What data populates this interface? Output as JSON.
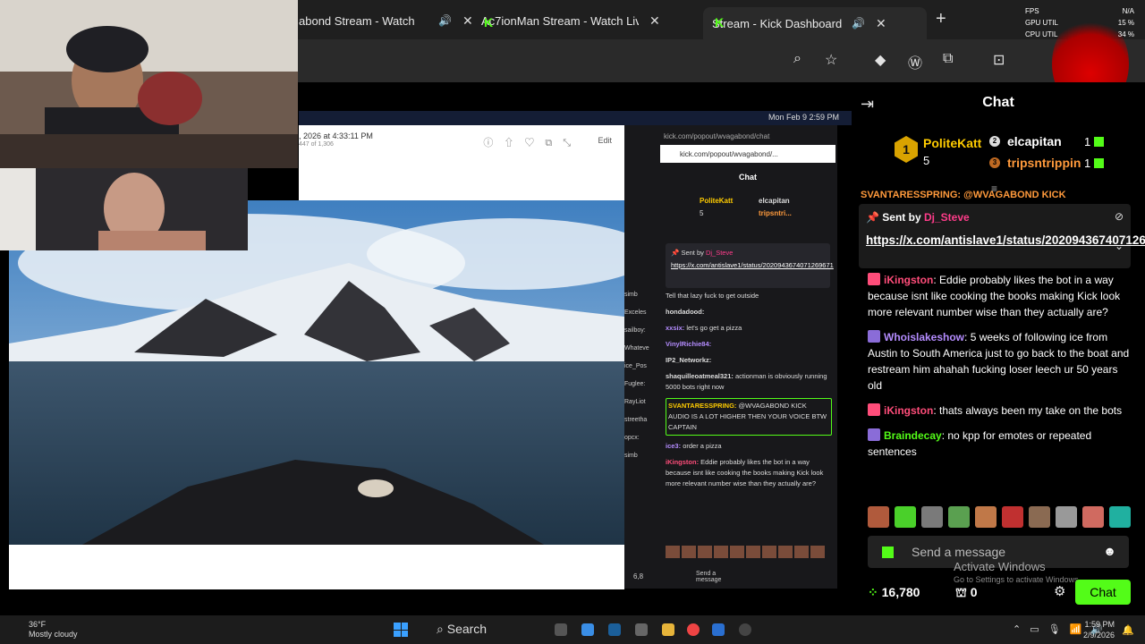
{
  "browser": {
    "tabs": [
      {
        "title": "abond Stream - Watch",
        "active": false
      },
      {
        "title": "Ac7ionMan Stream - Watch Liv",
        "active": false
      },
      {
        "title": "Stream - Kick Dashboard",
        "active": true
      }
    ],
    "new_tab_label": "+"
  },
  "overlay": {
    "fps_label": "FPS",
    "fps_value": "N/A",
    "gpu_label": "GPU UTIL",
    "gpu_value": "15 %",
    "cpu_label": "CPU UTIL",
    "cpu_value": "34 %"
  },
  "stream": {
    "mac_time": "Mon Feb 9  2:59 PM",
    "photo_date": ", 2026 at 4:33:11 PM",
    "photo_sub": "447 of 1,306",
    "photo_edit": "Edit",
    "inner": {
      "url1": "kick.com/popout/wvagabond/chat",
      "url2": "kick.com/popout/wvagabond/...",
      "chat_title": "Chat",
      "lead1": "PoliteKatt",
      "lead1_count": "5",
      "lead2": "elcapitan",
      "lead2_count": "1",
      "lead3": "tripsntri...",
      "lead3_count": "1",
      "pinned_by": "Sent by",
      "pinned_user": "Dj_Steve",
      "pinned_link": "https://x.com/antislave1/status/2020943674071269671",
      "side_labels": [
        "simb",
        "Exceles",
        "sailboy:",
        "Whateve",
        "ice_Pos",
        "Fuglee:",
        "RayLiot",
        "streetha",
        "opcx:",
        "simb"
      ],
      "messages": [
        {
          "user": "",
          "text": "Tell that lazy fuck to get outside"
        },
        {
          "user": "hondadood:",
          "text": ""
        },
        {
          "user": "xxsix:",
          "text": "let's go get a pizza"
        },
        {
          "user": "VinylRichie84:",
          "text": ""
        },
        {
          "user": "IP2_Networkz:",
          "text": ""
        },
        {
          "user": "shaquilleoatmeal321:",
          "text": "actionman is obviously running 5000 bots right now"
        },
        {
          "user": "SVANTARESSPRING:",
          "text": "@WVAGABOND KICK AUDIO IS A LOT HIGHER THEN YOUR VOICE BTW CAPTAIN"
        },
        {
          "user": "ice3:",
          "text": "order a pizza"
        },
        {
          "user": "iKingston:",
          "text": "Eddie probably likes the bot in a way because isnt like cooking the books making Kick look more relevant number wise than they actually are?"
        }
      ],
      "viewers": "6,8",
      "send_placeholder": "Send a message"
    }
  },
  "chat": {
    "title": "Chat",
    "leaderboard": [
      {
        "rank": "1",
        "name": "PoliteKatt",
        "count": "5"
      },
      {
        "rank": "2",
        "name": "elcapitan",
        "count": "1"
      },
      {
        "rank": "3",
        "name": "tripsntrippin",
        "count": "1"
      }
    ],
    "scroll_cut_line": "SVANTARESSPRING: @WVAGABOND KICK",
    "pinned": {
      "sent_by": "Sent by",
      "user": "Dj_Steve",
      "link": "https://x.com/antislave1/status/2020943674071269671"
    },
    "messages": [
      {
        "user": "iKingston",
        "text": ": Eddie probably likes the bot in a way because isnt like cooking the books making Kick look more relevant number wise than they actually are?"
      },
      {
        "user": "Whoislakeshow",
        "text": ": 5 weeks of following ice from Austin to South America just to go back to the boat and restream him ahahah fucking loser leech ur 50 years old"
      },
      {
        "user": "iKingston",
        "text": ": thats always been my take on the bots"
      },
      {
        "user": "Braindecay",
        "text": ": no kpp for emotes or repeated sentences"
      }
    ],
    "send_placeholder": "Send a message",
    "activate_title": "Activate Windows",
    "activate_sub": "Go to Settings to activate Windows.",
    "viewers": "16,780",
    "points": "0",
    "chat_button": "Chat"
  },
  "taskbar": {
    "weather_temp": "36°F",
    "weather_desc": "Mostly cloudy",
    "search_label": "Search",
    "time": "1:59 PM",
    "date": "2/9/2026"
  }
}
